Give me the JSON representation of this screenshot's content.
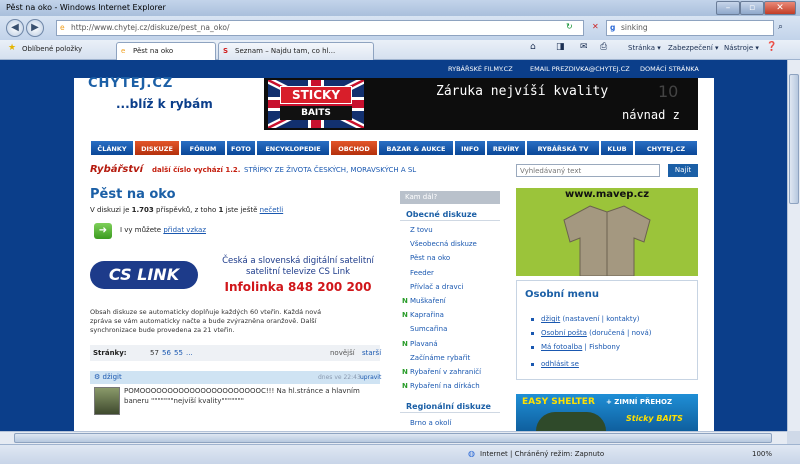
{
  "browser": {
    "title": "Pěst na oko - Windows Internet Explorer",
    "url": "http://www.chytej.cz/diskuze/pest_na_oko/",
    "search_value": "sinking",
    "favorites_label": "Oblíbené položky",
    "tabs": [
      "Pěst na oko",
      "Seznam – Najdu tam, co hl..."
    ],
    "commands": [
      "Stránka ▾",
      "Zabezpečení ▾",
      "Nástroje ▾"
    ],
    "status": "Internet | Chráněný režim: Zapnuto",
    "zoom": "100%"
  },
  "site": {
    "top_links": [
      "RYBÁŘSKÉ FILMY.CZ",
      "EMAIL PREZDIVKA@CHYTEJ.CZ",
      "DOMÁCÍ STRÁNKA"
    ],
    "logo_top": "CHYTEJ.CZ",
    "logo_tagline": "...blíž k rybám",
    "banner_brand_1": "STICKY",
    "banner_brand_2": "BAITS",
    "banner_text_1": "Záruka nejvíší kvality",
    "banner_text_2": "návnad z",
    "banner_num": "10",
    "menu": [
      "ČLÁNKY",
      "DISKUZE",
      "FÓRUM",
      "FOTO",
      "ENCYKLOPEDIE",
      "OBCHOD",
      "BAZAR & AUKCE",
      "INFO",
      "REVÍRY",
      "RYBÁŘSKÁ TV",
      "KLUB",
      "CHYTEJ.CZ"
    ],
    "ticker_logo": "Rybářství",
    "ticker_issue": "další číslo vychází 1.2.",
    "ticker_text": "STŘÍPKY ZE ŽIVOTA ČESKÝCH, MORAVSKÝCH A SL",
    "search_placeholder": "Vyhledávaný text",
    "search_button": "Najít"
  },
  "main": {
    "title": "Pěst na oko",
    "count_pre": "V diskuzi je",
    "count_posts": "1.703",
    "count_mid": "příspěvků, z toho",
    "count_unread": "1",
    "count_post": "jste ještě",
    "unread_link": "nečetli",
    "add_pre": "I vy můžete",
    "add_link": "přidat vzkaz",
    "ad_logo": "CS LINK",
    "ad_line1": "Česká a slovenská digitální satelitní",
    "ad_line2": "satelitní televize CS Link",
    "ad_phone": "Infolinka 848 200 200",
    "info": "Obsah diskuze se automaticky doplňuje každých 60 vteřin. Každá nová zpráva se vám automaticky načte a bude zvýrazněna oranžově. Další synchronizace bude provedena za 21 vteřin.",
    "pages_label": "Stránky:",
    "pages": [
      "57",
      "56",
      "55",
      "..."
    ],
    "newer": "novější",
    "older": "starší",
    "post_user": "džigit",
    "post_meta": "dnes ve 22:43",
    "post_reply": "upravit",
    "post_text": "POMOOOOOOOOOOOOOOOOOOOOOOC!!! Na hl.stránce a hlavním baneru \"\"\"\"\"\"\"nejvíší kvality\"\"\"\"\"\"\""
  },
  "side": {
    "header": "Kam dál?",
    "general_title": "Obecné diskuze",
    "general": [
      {
        "n": "",
        "label": "Z tovu"
      },
      {
        "n": "",
        "label": "Všeobecná diskuze"
      },
      {
        "n": "",
        "label": "Pěst na oko"
      },
      {
        "n": "",
        "label": "Feeder"
      },
      {
        "n": "",
        "label": "Přívlač a dravci"
      },
      {
        "n": "N",
        "label": "Muškaření"
      },
      {
        "n": "N",
        "label": "Kaprařina"
      },
      {
        "n": "",
        "label": "Sumcařina"
      },
      {
        "n": "N",
        "label": "Plavaná"
      },
      {
        "n": "",
        "label": "Začínáme rybařit"
      },
      {
        "n": "N",
        "label": "Rybaření v zahraničí"
      },
      {
        "n": "N",
        "label": "Rybaření na dírkách"
      }
    ],
    "regional_title": "Regionální diskuze",
    "regional": [
      "Brno a okolí"
    ]
  },
  "right": {
    "mavep": "www.mavep.cz",
    "menu_title": "Osobní menu",
    "items": [
      [
        "džigit",
        "(nastavení | kontakty)"
      ],
      [
        "Osobní pošta",
        "(doručená | nová)"
      ],
      [
        "Má fotoalba",
        "| Fishbony"
      ],
      [
        "odhlásit se",
        ""
      ]
    ],
    "shelter_title": "EASY SHELTER",
    "shelter_sub": "+ ZIMNÍ PŘEHOZ",
    "shelter_brand": "Sticky BAITS"
  }
}
